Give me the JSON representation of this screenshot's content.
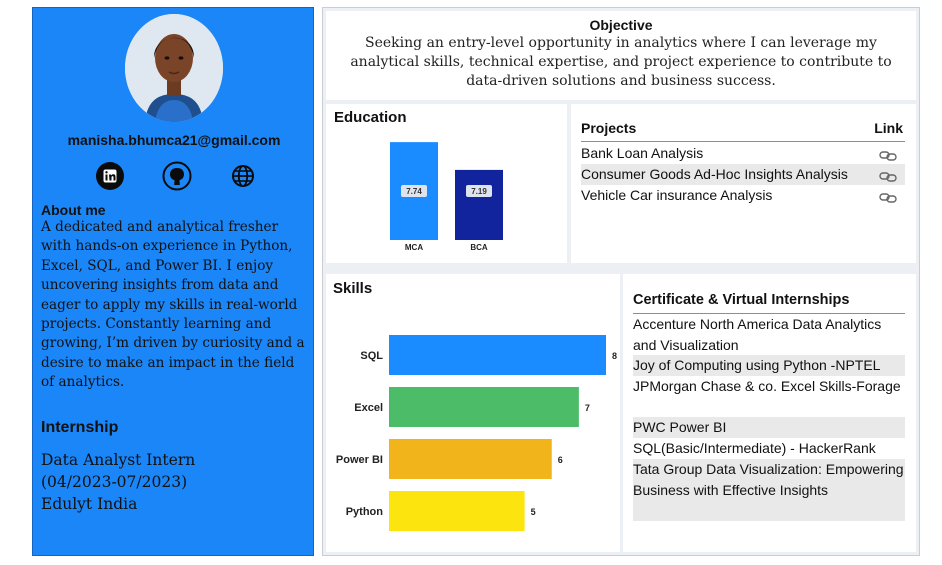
{
  "sidebar": {
    "email": "manisha.bhumca21@gmail.com",
    "social_icons": [
      "linkedin-icon",
      "github-icon",
      "globe-icon"
    ],
    "about_heading": "About me",
    "about_text": "A dedicated and analytical fresher with hands-on experience in Python, Excel, SQL, and Power BI. I enjoy uncovering insights from data and eager to apply my skills in real-world projects. Constantly learning and growing, I’m driven by curiosity and a desire to make an impact in the field of analytics.",
    "internship_heading": "Internship",
    "internship_lines": [
      "Data Analyst Intern",
      "(04/2023-07/2023)",
      "Edulyt India"
    ]
  },
  "objective": {
    "title": "Objective",
    "text": "Seeking an entry-level opportunity in analytics where I can leverage my analytical skills, technical expertise, and project experience to contribute to data-driven solutions and business success."
  },
  "education": {
    "title": "Education"
  },
  "projects": {
    "title": "Projects",
    "link_header": "Link",
    "items": [
      {
        "name": "Bank Loan Analysis",
        "icon": "link-icon"
      },
      {
        "name": "Consumer Goods Ad-Hoc Insights Analysis",
        "icon": "link-icon"
      },
      {
        "name": "Vehicle Car insurance Analysis",
        "icon": "link-icon"
      }
    ]
  },
  "skills": {
    "title": "Skills"
  },
  "certificates": {
    "title": "Certificate & Virtual Internships",
    "items": [
      "Accenture North America Data Analytics and Visualization",
      "Joy of Computing using Python -NPTEL",
      "JPMorgan Chase & co. Excel Skills-Forage",
      "PWC Power BI",
      "SQL(Basic/Intermediate) - HackerRank",
      "Tata Group Data Visualization: Empowering Business with Effective Insights"
    ]
  },
  "chart_data": [
    {
      "type": "bar",
      "title": "Education",
      "categories": [
        "MCA",
        "BCA"
      ],
      "values": [
        7.74,
        7.19
      ],
      "colors": [
        "#1a8cff",
        "#12239e"
      ],
      "ylim": [
        6,
        8
      ]
    },
    {
      "type": "bar",
      "orientation": "horizontal",
      "title": "Skills",
      "categories": [
        "SQL",
        "Excel",
        "Power BI",
        "Python"
      ],
      "values": [
        8,
        7,
        6,
        5
      ],
      "colors": [
        "#1a8cff",
        "#4cbc68",
        "#f2b41b",
        "#fce50e"
      ],
      "xlim": [
        0,
        8
      ]
    }
  ]
}
